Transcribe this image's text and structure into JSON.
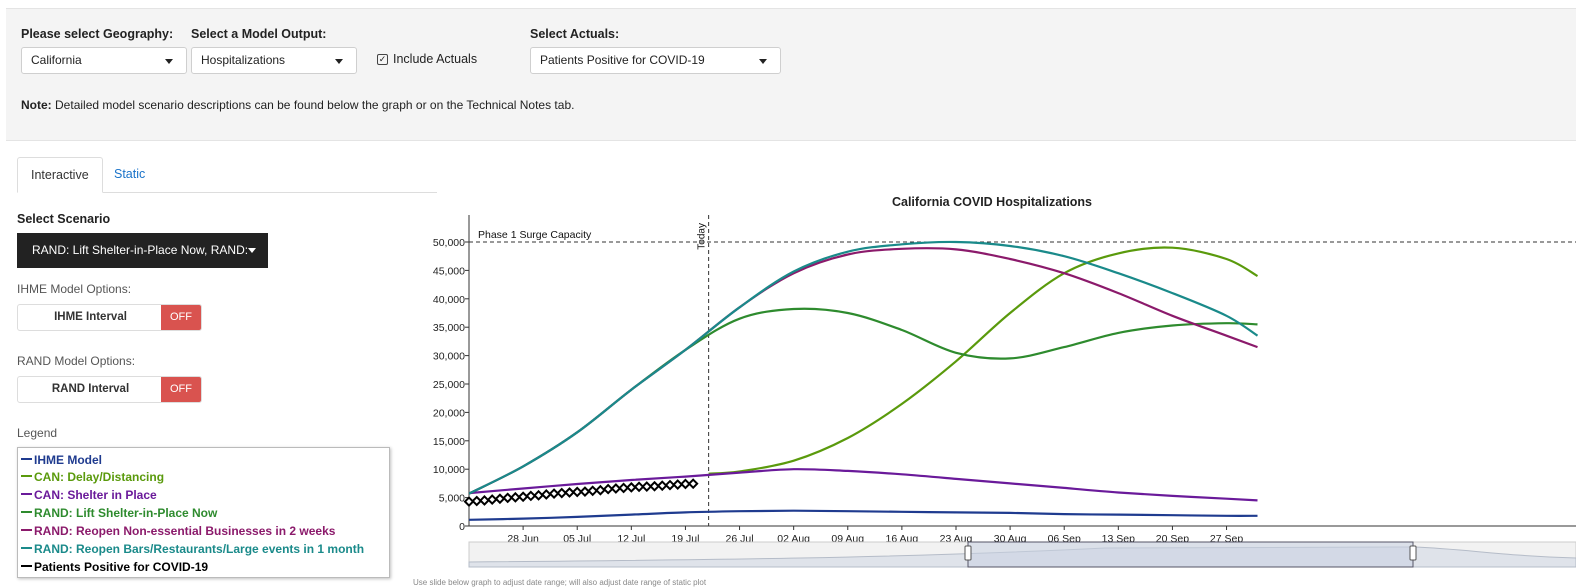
{
  "controls": {
    "geography_label": "Please select Geography:",
    "geography_value": "California",
    "model_label": "Select a Model Output:",
    "model_value": "Hospitalizations",
    "include_actuals_label": "Include Actuals",
    "include_actuals_checked": true,
    "actuals_label": "Select Actuals:",
    "actuals_value": "Patients Positive for COVID-19"
  },
  "note": {
    "bold": "Note:",
    "text": "Detailed model scenario descriptions can be found below the graph or on the Technical Notes tab."
  },
  "tabs": [
    {
      "label": "Interactive",
      "active": true
    },
    {
      "label": "Static",
      "active": false
    }
  ],
  "sidebar": {
    "scenario_heading": "Select Scenario",
    "scenario_value": "RAND: Lift Shelter-in-Place Now, RAND:",
    "ihme_options_label": "IHME Model Options:",
    "ihme_toggle_label": "IHME Interval",
    "ihme_toggle_state": "OFF",
    "rand_options_label": "RAND Model Options:",
    "rand_toggle_label": "RAND Interval",
    "rand_toggle_state": "OFF",
    "legend_heading": "Legend"
  },
  "legend": [
    {
      "label": "IHME Model",
      "color": "#1f3b8f"
    },
    {
      "label": "CAN: Delay/Distancing",
      "color": "#5a9a0c"
    },
    {
      "label": "CAN: Shelter in Place",
      "color": "#6a1a9a"
    },
    {
      "label": "RAND: Lift Shelter-in-Place Now",
      "color": "#2e8b2e"
    },
    {
      "label": "RAND: Reopen Non-essential Businesses in 2 weeks",
      "color": "#8b1a6b"
    },
    {
      "label": "RAND: Reopen Bars/Restaurants/Large events in 1 month",
      "color": "#1a8a8a"
    },
    {
      "label": "Patients Positive for COVID-19",
      "color": "#000000"
    }
  ],
  "slider_hint": "Use slide below graph to adjust date range; will also adjust date range of static plot",
  "chart_data": {
    "type": "line",
    "title": "California COVID Hospitalizations",
    "xlabel": "",
    "ylabel": "",
    "x_ticks": [
      "28 Jun",
      "05 Jul",
      "12 Jul",
      "19 Jul",
      "26 Jul",
      "02 Aug",
      "09 Aug",
      "16 Aug",
      "23 Aug",
      "30 Aug",
      "06 Sep",
      "13 Sep",
      "20 Sep",
      "27 Sep"
    ],
    "y_ticks": [
      "0",
      "5,000",
      "10,000",
      "15,000",
      "20,000",
      "25,000",
      "30,000",
      "35,000",
      "40,000",
      "45,000",
      "50,000"
    ],
    "ylim": [
      0,
      52000
    ],
    "x_range": [
      "2020-06-21",
      "2020-10-01"
    ],
    "grid": false,
    "annotations": [
      {
        "type": "hline",
        "y": 50000,
        "label": "Phase 1 Surge Capacity"
      },
      {
        "type": "vline",
        "x": "2020-07-22",
        "label": "Today"
      }
    ],
    "series": [
      {
        "name": "IHME Model",
        "color": "#1f3b8f",
        "x": [
          "2020-06-21",
          "2020-06-28",
          "2020-07-05",
          "2020-07-12",
          "2020-07-19",
          "2020-07-26",
          "2020-08-02",
          "2020-08-09",
          "2020-08-16",
          "2020-08-23",
          "2020-08-30",
          "2020-09-06",
          "2020-09-13",
          "2020-09-20",
          "2020-09-27",
          "2020-10-01"
        ],
        "y": [
          1100,
          1300,
          1600,
          2000,
          2400,
          2600,
          2700,
          2600,
          2500,
          2400,
          2300,
          2100,
          2000,
          1900,
          1800,
          1800
        ]
      },
      {
        "name": "CAN: Delay/Distancing",
        "color": "#5a9a0c",
        "x": [
          "2020-07-22",
          "2020-07-26",
          "2020-08-02",
          "2020-08-09",
          "2020-08-16",
          "2020-08-23",
          "2020-08-30",
          "2020-09-06",
          "2020-09-13",
          "2020-09-20",
          "2020-09-27",
          "2020-10-01"
        ],
        "y": [
          9200,
          9600,
          11500,
          15500,
          21500,
          29000,
          37500,
          44500,
          48000,
          49000,
          47000,
          44000
        ]
      },
      {
        "name": "CAN: Shelter in Place",
        "color": "#6a1a9a",
        "x": [
          "2020-06-21",
          "2020-06-28",
          "2020-07-05",
          "2020-07-12",
          "2020-07-19",
          "2020-07-26",
          "2020-08-02",
          "2020-08-09",
          "2020-08-16",
          "2020-08-23",
          "2020-08-30",
          "2020-09-06",
          "2020-09-13",
          "2020-09-20",
          "2020-09-27",
          "2020-10-01"
        ],
        "y": [
          5800,
          6600,
          7400,
          8100,
          8700,
          9400,
          10000,
          9700,
          9100,
          8300,
          7500,
          6700,
          5900,
          5300,
          4800,
          4500
        ]
      },
      {
        "name": "RAND: Lift Shelter-in-Place Now",
        "color": "#2e8b2e",
        "x": [
          "2020-06-21",
          "2020-06-28",
          "2020-07-05",
          "2020-07-12",
          "2020-07-19",
          "2020-07-26",
          "2020-08-02",
          "2020-08-09",
          "2020-08-16",
          "2020-08-23",
          "2020-08-30",
          "2020-09-06",
          "2020-09-13",
          "2020-09-20",
          "2020-09-27",
          "2020-10-01"
        ],
        "y": [
          5700,
          10500,
          16500,
          24000,
          31000,
          36500,
          38200,
          37500,
          34500,
          30500,
          29500,
          31500,
          34000,
          35300,
          35700,
          35500
        ]
      },
      {
        "name": "RAND: Reopen Non-essential Businesses in 2 weeks",
        "color": "#8b1a6b",
        "x": [
          "2020-06-21",
          "2020-06-28",
          "2020-07-05",
          "2020-07-12",
          "2020-07-19",
          "2020-07-26",
          "2020-08-02",
          "2020-08-09",
          "2020-08-16",
          "2020-08-23",
          "2020-08-30",
          "2020-09-06",
          "2020-09-13",
          "2020-09-20",
          "2020-09-27",
          "2020-10-01"
        ],
        "y": [
          5700,
          10500,
          16500,
          24000,
          31000,
          38500,
          44500,
          47800,
          48800,
          48700,
          47000,
          44500,
          41000,
          37000,
          33500,
          31500
        ]
      },
      {
        "name": "RAND: Reopen Bars/Restaurants/Large events in 1 month",
        "color": "#1a8a8a",
        "x": [
          "2020-06-21",
          "2020-06-28",
          "2020-07-05",
          "2020-07-12",
          "2020-07-19",
          "2020-07-26",
          "2020-08-02",
          "2020-08-09",
          "2020-08-16",
          "2020-08-23",
          "2020-08-30",
          "2020-09-06",
          "2020-09-13",
          "2020-09-20",
          "2020-09-27",
          "2020-10-01"
        ],
        "y": [
          5700,
          10500,
          16500,
          24000,
          31000,
          38500,
          44800,
          48300,
          49600,
          50000,
          49300,
          47500,
          44500,
          41000,
          37000,
          33500
        ]
      },
      {
        "name": "Patients Positive for COVID-19",
        "color": "#000000",
        "marker": "diamond",
        "x": [
          "2020-06-21",
          "2020-06-22",
          "2020-06-23",
          "2020-06-24",
          "2020-06-25",
          "2020-06-26",
          "2020-06-27",
          "2020-06-28",
          "2020-06-29",
          "2020-06-30",
          "2020-07-01",
          "2020-07-02",
          "2020-07-03",
          "2020-07-04",
          "2020-07-05",
          "2020-07-06",
          "2020-07-07",
          "2020-07-08",
          "2020-07-09",
          "2020-07-10",
          "2020-07-11",
          "2020-07-12",
          "2020-07-13",
          "2020-07-14",
          "2020-07-15",
          "2020-07-16",
          "2020-07-17",
          "2020-07-18",
          "2020-07-19",
          "2020-07-20"
        ],
        "y": [
          4300,
          4400,
          4500,
          4650,
          4800,
          4950,
          5050,
          5150,
          5300,
          5400,
          5550,
          5700,
          5800,
          5900,
          6000,
          6050,
          6200,
          6300,
          6500,
          6600,
          6700,
          6800,
          6900,
          6950,
          7000,
          7100,
          7200,
          7300,
          7400,
          7450
        ]
      }
    ]
  }
}
